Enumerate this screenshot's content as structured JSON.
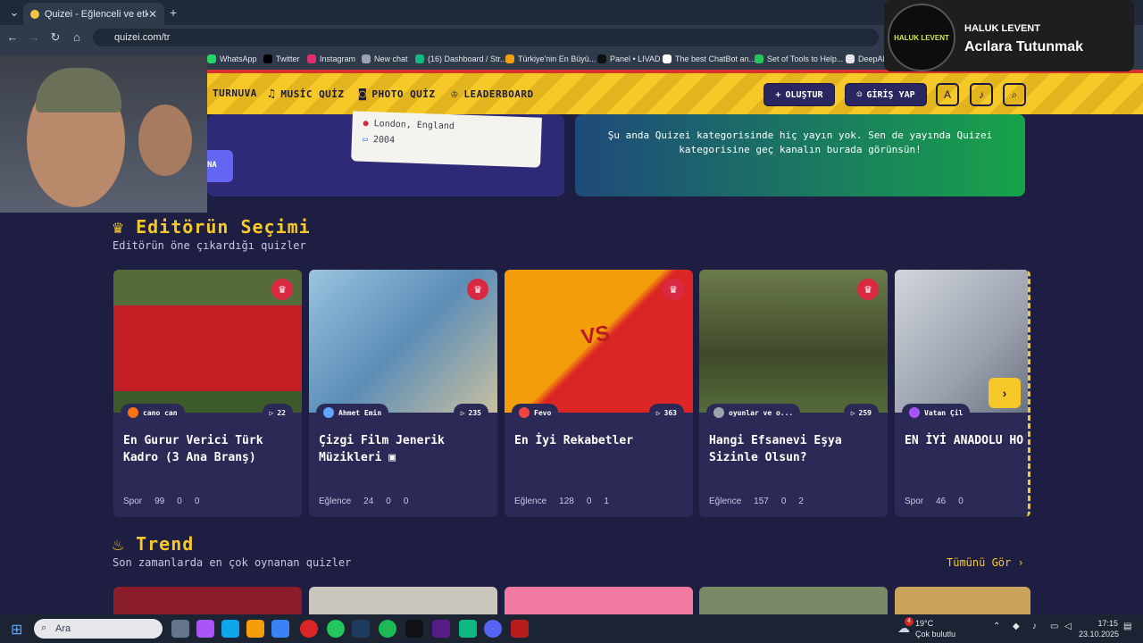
{
  "browser": {
    "tab_title": "Quizei - Eğlenceli ve etkileşim...",
    "tab_close": "✕",
    "new_tab": "+",
    "url": "quizei.com/tr",
    "bookmarks": [
      "WhatsApp",
      "Twitter",
      "Instagram",
      "New chat",
      "(16) Dashboard / Str...",
      "Türkiye'nin En Büyü...",
      "Panel • LIVAD",
      "The best ChatBot an...",
      "Set of Tools to Help...",
      "DeepAI"
    ]
  },
  "overlay": {
    "artist": "HALUK LEVENT",
    "song": "Acılara Tutunmak",
    "avatar_text": "HALUK LEVENT"
  },
  "nav": {
    "tournament": "TURNUVA",
    "music_quiz": "MUSİC QUİZ",
    "photo_quiz": "PHOTO QUİZ",
    "leaderboard": "LEADERBOARD",
    "create": "OLUŞTUR",
    "login": "GİRİŞ YAP"
  },
  "hero": {
    "location": "London, England",
    "year": "2004",
    "button_fragment": "NA",
    "no_stream_msg": "Şu anda Quizei kategorisinde hiç yayın yok. Sen de yayında Quizei kategorisine geç kanalın burada görünsün!"
  },
  "editors_choice": {
    "title": "Editörün Seçimi",
    "subtitle": "Editörün öne çıkardığı quizler",
    "cards": [
      {
        "author": "cano can",
        "plays": "22",
        "title": "En Gurur Verici Türk Kadro (3 Ana Branş)",
        "category": "Spor",
        "questions": "99",
        "comments": "0",
        "likes": "0"
      },
      {
        "author": "Ahmet Emin",
        "plays": "235",
        "title": "Çizgi Film Jenerik Müzikleri",
        "category": "Eğlence",
        "questions": "24",
        "comments": "0",
        "likes": "0"
      },
      {
        "author": "Fevo",
        "plays": "363",
        "title": "En İyi Rekabetler",
        "category": "Eğlence",
        "questions": "128",
        "comments": "0",
        "likes": "1"
      },
      {
        "author": "oyunlar ve o...",
        "plays": "259",
        "title": "Hangi Efsanevi Eşya Sizinle Olsun?",
        "category": "Eğlence",
        "questions": "157",
        "comments": "0",
        "likes": "2"
      },
      {
        "author": "Vatan Çil",
        "plays": "",
        "title": "EN İYİ ANADOLU HO",
        "category": "Spor",
        "questions": "46",
        "comments": "0",
        "likes": ""
      }
    ]
  },
  "trend": {
    "title": "Trend",
    "subtitle": "Son zamanlarda en çok oynanan quizler",
    "see_all": "Tümünü Gör ›"
  },
  "taskbar": {
    "search_placeholder": "Ara",
    "weather_temp": "19°C",
    "weather_desc": "Çok bulutlu",
    "weather_badge": "4",
    "time": "17:15",
    "date": "23.10.2025"
  },
  "colors": {
    "accent": "#f6c928",
    "bg": "#1e1d42",
    "card": "#2b2a57",
    "crown": "#d92842"
  }
}
